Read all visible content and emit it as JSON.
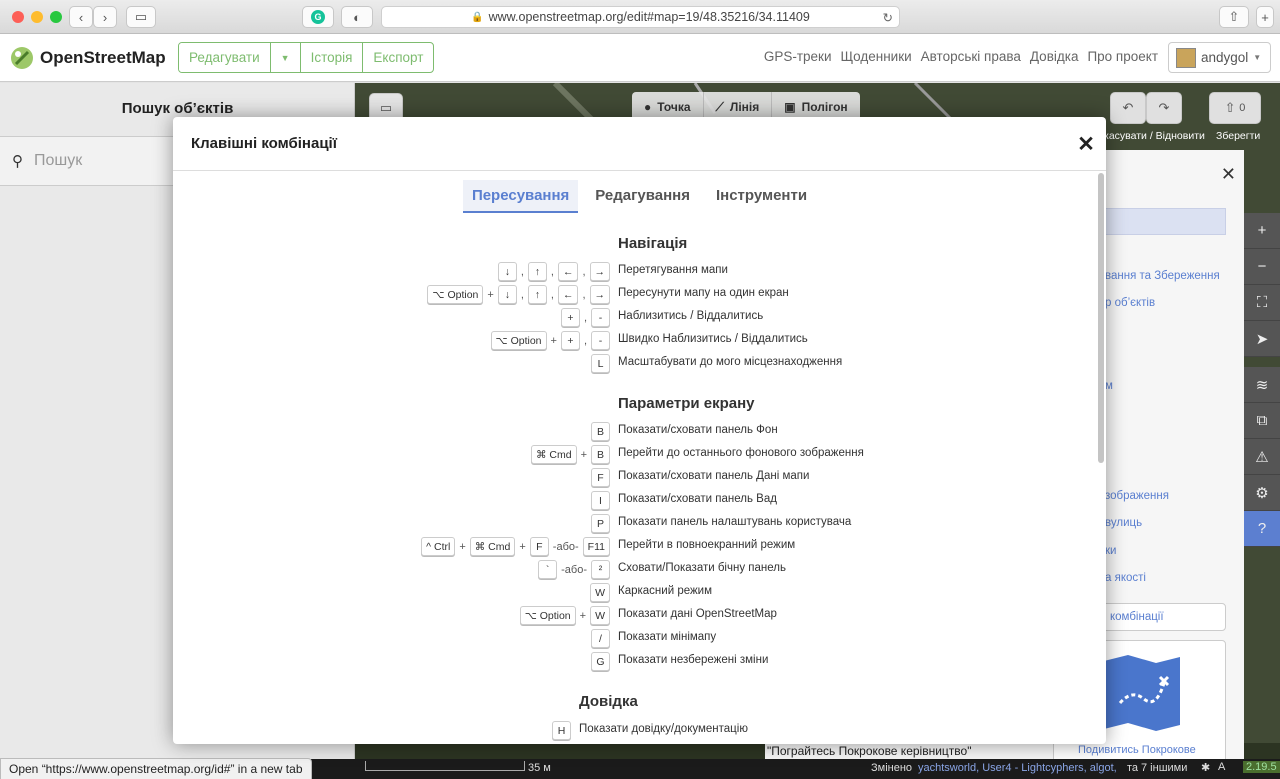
{
  "browser": {
    "url": "www.openstreetmap.org/edit#map=19/48.35216/34.11409",
    "link_hover": "Open “https://www.openstreetmap.org/id#” in a new tab"
  },
  "header": {
    "logo": "OpenStreetMap",
    "edit": "Редагувати",
    "history": "Історія",
    "export": "Експорт",
    "links": [
      "GPS-треки",
      "Щоденники",
      "Авторські права",
      "Довідка",
      "Про проект"
    ],
    "user": "andygol"
  },
  "left_panel": {
    "title": "Пошук об’єктів",
    "search_placeholder": "Пошук"
  },
  "map_toolbar": {
    "point": "Точка",
    "line": "Лінія",
    "area": "Полігон",
    "undo_redo": "касувати / Відновити",
    "save": "Зберегти",
    "save_count": "0"
  },
  "right_panel_fragments": [
    "вання та Збереження",
    "р об’єктів",
    "м",
    "зображення",
    "вулиць",
    "ки",
    "а якості",
    "комбінації",
    "\"Пограйтесь Покрокове керівництво\"",
    "Подивитись Покрокове"
  ],
  "status_bar": {
    "scale": "35 м",
    "changed_label": "Змінено",
    "changed_by": "yachtsworld, User4 - Lightcyphers, algot,",
    "and": "та",
    "others": "7 іншими",
    "version": "2.19.5"
  },
  "modal": {
    "title": "Клавішні комбінації",
    "tabs": [
      "Пересування",
      "Редагування",
      "Інструменти"
    ],
    "active_tab": 0,
    "sections": [
      {
        "title": "Навігація",
        "rows": [
          {
            "keys": [
              "↓",
              ",",
              "↑",
              ",",
              "←",
              ",",
              "→"
            ],
            "desc": "Перетягування мапи"
          },
          {
            "keys": [
              "⌥ Option",
              "+",
              "↓",
              ",",
              "↑",
              ",",
              "←",
              ",",
              "→"
            ],
            "desc": "Пересунути мапу на один екран"
          },
          {
            "keys": [
              "+",
              ",",
              "-"
            ],
            "desc": "Наблизитись / Віддалитись"
          },
          {
            "keys": [
              "⌥ Option",
              "+",
              "+",
              ",",
              "-"
            ],
            "desc": "Швидко Наблизитись / Віддалитись"
          },
          {
            "keys": [
              "L"
            ],
            "desc": "Масштабувати до мого місцезнаходження"
          }
        ]
      },
      {
        "title": "Параметри екрану",
        "rows": [
          {
            "keys": [
              "B"
            ],
            "desc": "Показати/сховати панель Фон"
          },
          {
            "keys": [
              "⌘ Cmd",
              "+",
              "B"
            ],
            "desc": "Перейти до останнього фонового зображення"
          },
          {
            "keys": [
              "F"
            ],
            "desc": "Показати/сховати панель Дані мапи"
          },
          {
            "keys": [
              "I"
            ],
            "desc": "Показати/сховати панель Вад"
          },
          {
            "keys": [
              "P"
            ],
            "desc": "Показати панель налаштувань користувача"
          },
          {
            "keys": [
              "^ Ctrl",
              "+",
              "⌘ Cmd",
              "+",
              "F",
              "-або-",
              "F11"
            ],
            "desc": "Перейти в повноекранний режим"
          },
          {
            "keys": [
              "`",
              "-або-",
              "²"
            ],
            "desc": "Сховати/Показати бічну панель"
          },
          {
            "keys": [
              "W"
            ],
            "desc": "Каркасний режим"
          },
          {
            "keys": [
              "⌥ Option",
              "+",
              "W"
            ],
            "desc": "Показати дані OpenStreetMap"
          },
          {
            "keys": [
              "/"
            ],
            "desc": "Показати мінімапу"
          },
          {
            "keys": [
              "G"
            ],
            "desc": "Показати незбережені зміни"
          }
        ]
      },
      {
        "title": "Довідка",
        "rows": [
          {
            "keys": [
              "H"
            ],
            "desc": "Показати довідку/документацію"
          }
        ]
      }
    ]
  }
}
